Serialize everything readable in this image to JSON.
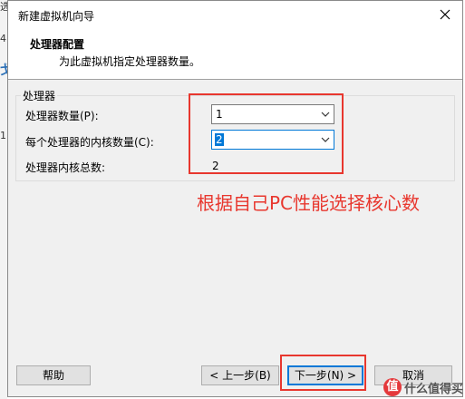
{
  "background": {
    "fragments": [
      "选",
      "4",
      "",
      "戈",
      "1"
    ]
  },
  "dialog": {
    "title": "新建虚拟机向导",
    "header": {
      "title": "处理器配置",
      "subtitle": "为此虚拟机指定处理器数量。"
    },
    "group": {
      "label": "处理器",
      "rows": {
        "processor_count": {
          "label": "处理器数量(P):",
          "value": "1"
        },
        "cores_per_processor": {
          "label": "每个处理器的内核数量(C):",
          "value": "2"
        },
        "total_cores": {
          "label": "处理器内核总数:",
          "value": "2"
        }
      }
    },
    "annotation": "根据自己PC性能选择核心数",
    "buttons": {
      "help": "帮助",
      "back": "< 上一步(B)",
      "next": "下一步(N) >",
      "cancel": "取消"
    }
  },
  "watermark": {
    "icon_text": "值",
    "text": "什么值得买"
  },
  "colors": {
    "annotation": "#e8372e",
    "focus": "#0078d7",
    "dialog_bg": "#f0f0f0"
  }
}
